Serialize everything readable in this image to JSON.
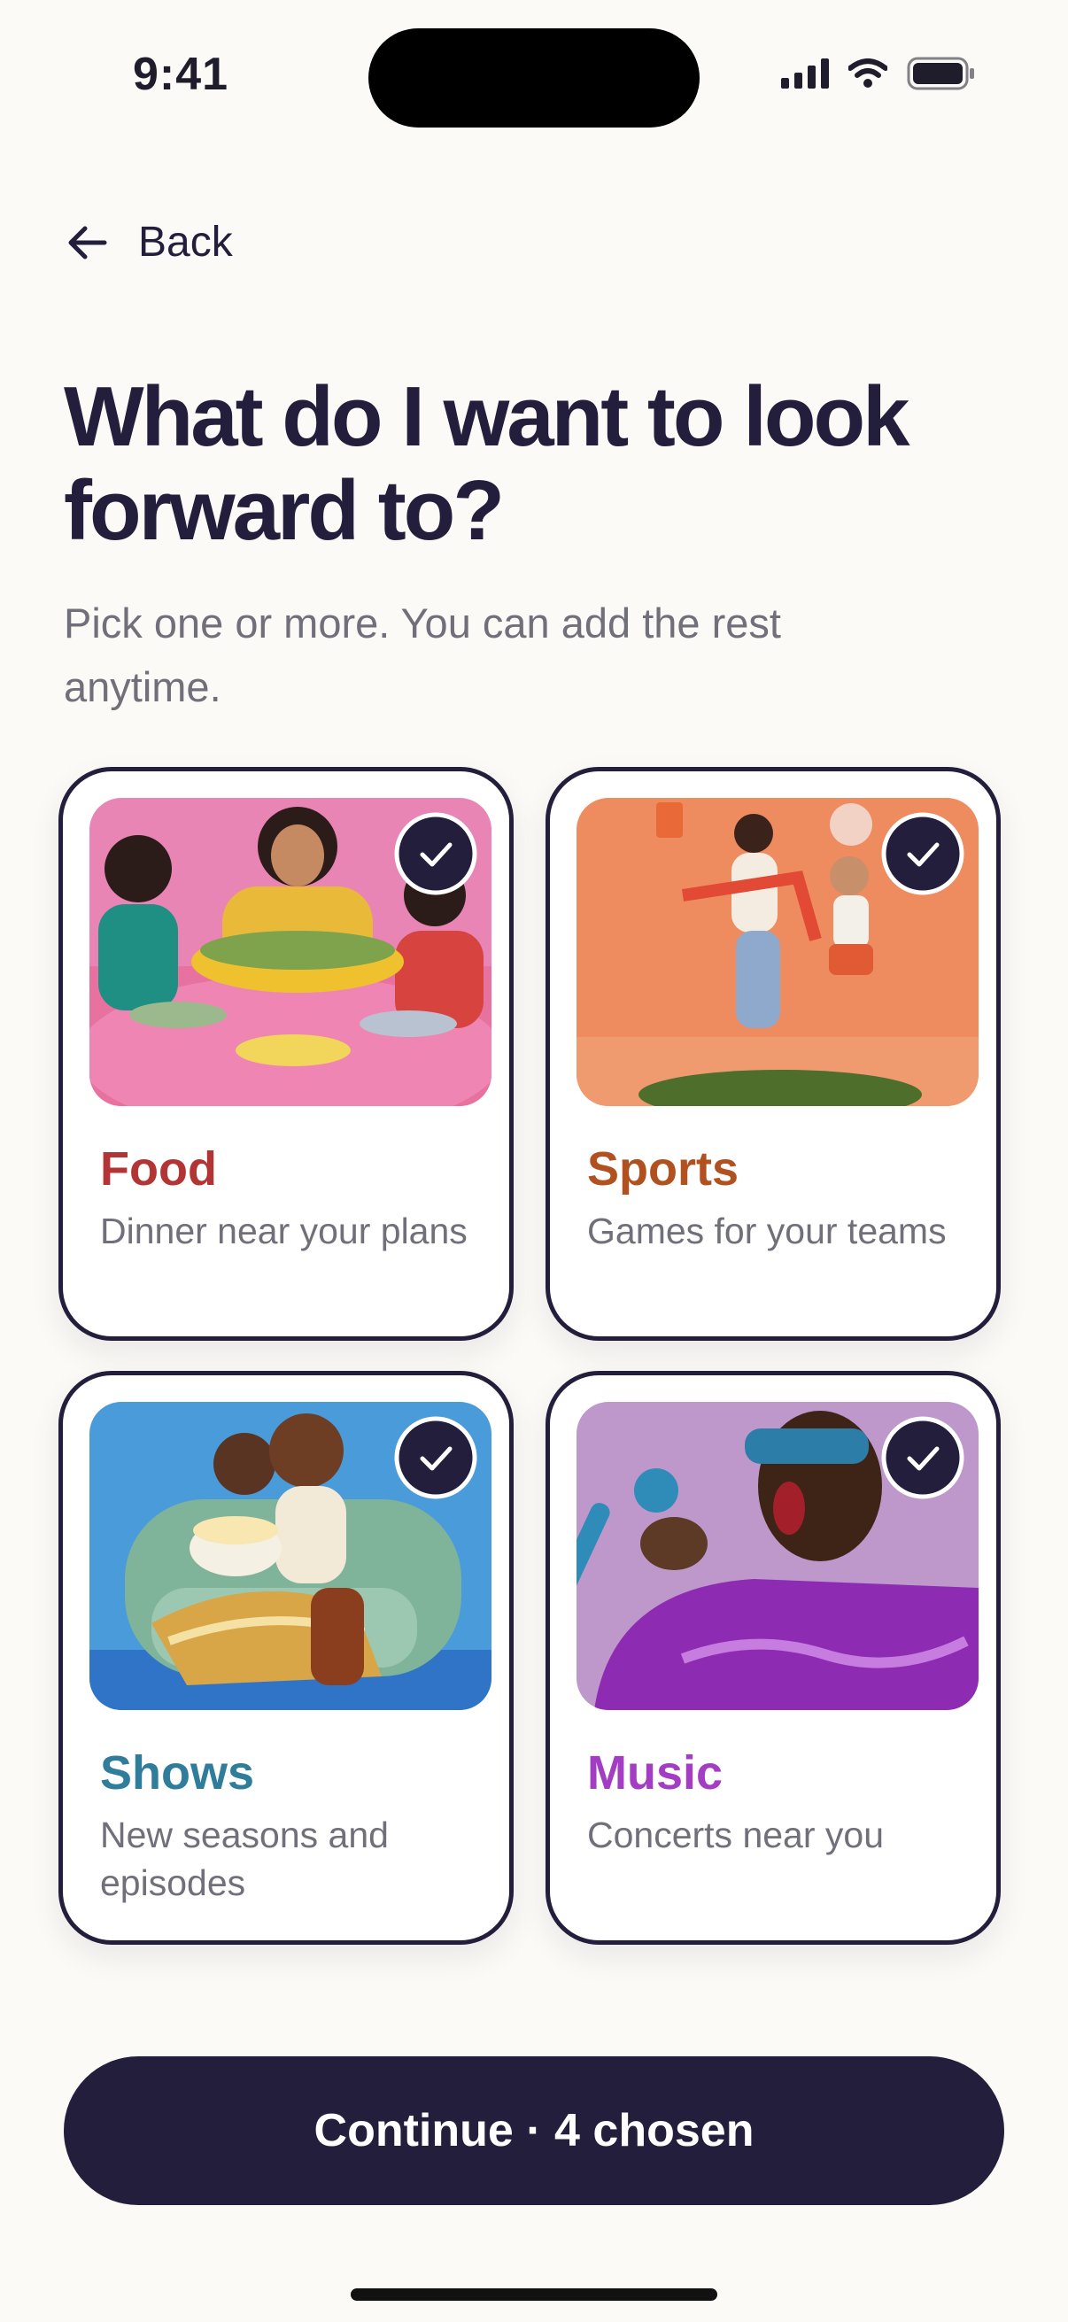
{
  "status_bar": {
    "time": "9:41"
  },
  "nav": {
    "back_label": "Back",
    "back_icon": "arrow-left-icon"
  },
  "header": {
    "title": "What do I want to look forward to?",
    "subtitle": "Pick one or more. You can add the rest anytime."
  },
  "cards": [
    {
      "title": "Food",
      "description": "Dinner near your plans",
      "color": "#B23434",
      "selected": true
    },
    {
      "title": "Sports",
      "description": "Games for your teams",
      "color": "#B1511F",
      "selected": true
    },
    {
      "title": "Shows",
      "description": "New seasons and episodes",
      "color": "#2F7D9B",
      "selected": true
    },
    {
      "title": "Music",
      "description": "Concerts near you",
      "color": "#A33DC4",
      "selected": true
    }
  ],
  "footer": {
    "continue_label": "Continue · 4 chosen"
  },
  "colors": {
    "primary": "#231E3C",
    "background": "#FBFAF6",
    "muted_text": "#71707A"
  }
}
